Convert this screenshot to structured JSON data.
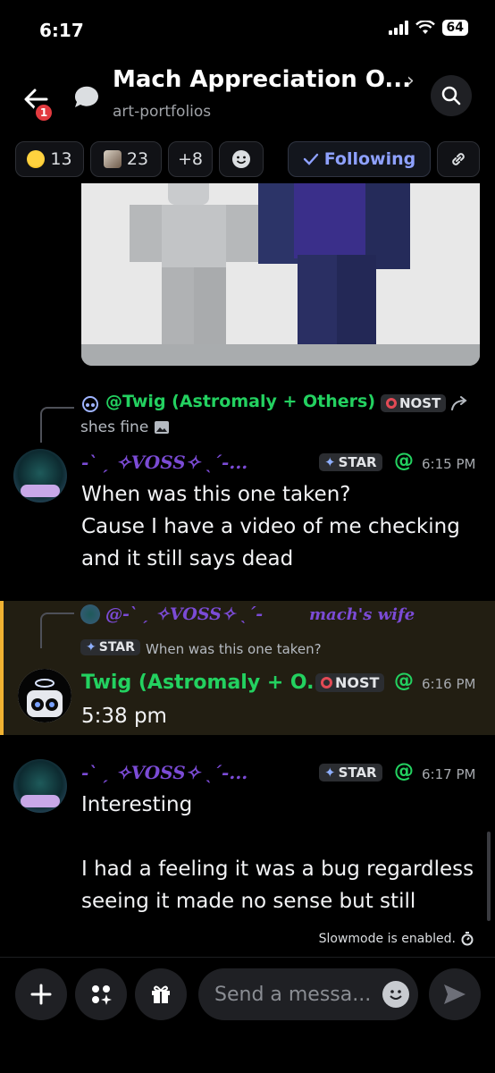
{
  "status": {
    "time": "6:17",
    "battery": "64"
  },
  "header": {
    "title": "Mach Appreciation O...",
    "subtitle": "art-portfolios",
    "notif_count": "1"
  },
  "chips": [
    {
      "emoji": "scared-face",
      "count": "13"
    },
    {
      "emoji": "cat-avatar",
      "count": "23"
    },
    {
      "label": "+8"
    }
  ],
  "following_label": "Following",
  "messages": {
    "m1_reply": {
      "name": "@Twig (Astromaly + Others)",
      "tag": "NOST",
      "text": "shes fine"
    },
    "m1": {
      "author": "-ˋ ˏ ✧VOSS✧ ˎˊ-...",
      "tag": "STAR",
      "time": "6:15 PM",
      "line1": "When was this one taken?",
      "line2": "Cause I have a video of me checking",
      "line3": "and it still says dead"
    },
    "m2_reply": {
      "name": "@-ˋ ˏ ✧VOSS✧ ˎˊ-",
      "suffix": "mach's wife",
      "tag": "STAR",
      "text": "When was this one taken?"
    },
    "m2": {
      "author": "Twig (Astromaly + O...",
      "tag": "NOST",
      "time": "6:16 PM",
      "text": "5:38 pm"
    },
    "m3": {
      "author": "-ˋ ˏ ✧VOSS✧ ˎˊ-...",
      "tag": "STAR",
      "time": "6:17 PM",
      "line1": "Interesting",
      "line2": "I had a feeling it was a bug regardless",
      "line3": "seeing it made no sense but still"
    }
  },
  "slowmode": "Slowmode is enabled.",
  "composer": {
    "placeholder": "Send a messa..."
  },
  "colors": {
    "accent": "#8ea1ff",
    "twig_green": "#23d160",
    "voss_purple": "#7b4bd6",
    "highlight": "#f0b232"
  }
}
